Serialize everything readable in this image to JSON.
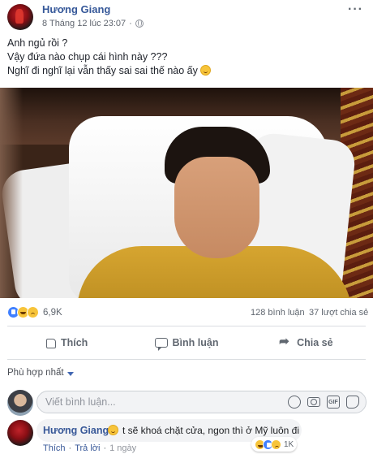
{
  "post": {
    "author": "Hương Giang",
    "timestamp": "8 Tháng 12 lúc 23:07",
    "privacy_separator": "·",
    "more_label": "···",
    "lines": [
      "Anh ngủ rồi ?",
      "Vậy đứa nào chụp cái hình này ???",
      "Nghĩ đi nghĩ lại vẫn thấy sai sai thế nào ấy"
    ]
  },
  "stats": {
    "reactions": [
      "like",
      "haha",
      "sad"
    ],
    "reaction_count": "6,9K",
    "comments": "128 bình luận",
    "shares": "37 lượt chia sẻ"
  },
  "actions": {
    "like": "Thích",
    "comment": "Bình luận",
    "share": "Chia sẻ"
  },
  "comments_section": {
    "sort_label": "Phù hợp nhất",
    "composer_placeholder": "Viết bình luận...",
    "gif_label": "GIF",
    "top_comment": {
      "author": "Hương Giang",
      "text": "t sẽ khoá chặt cửa, ngon thì ở Mỹ luôn đi",
      "reactions": [
        "haha",
        "like",
        "sad"
      ],
      "reaction_count": "1K",
      "like_label": "Thích",
      "reply_label": "Trả lời",
      "separator": "·",
      "time": "1 ngày"
    }
  },
  "colors": {
    "link_blue": "#365899",
    "meta_gray": "#616770",
    "divider": "#dadde1",
    "composer_bg": "#f2f3f5"
  }
}
